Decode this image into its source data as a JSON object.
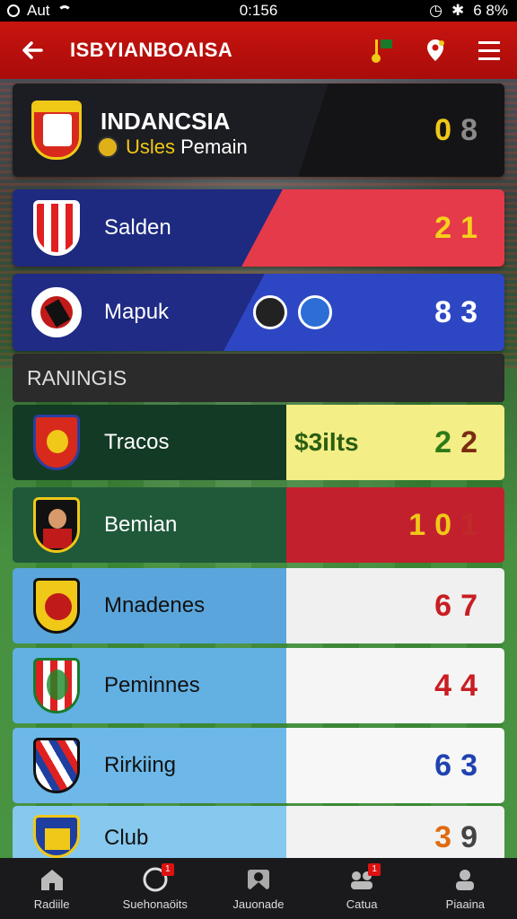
{
  "status_bar": {
    "left_text": "Aut",
    "time": "0:156",
    "battery": "6 8%"
  },
  "app_bar": {
    "title": "ISBYIANBOAISA",
    "back_icon": "back-arrow-icon",
    "actions": [
      "flag-icon",
      "location-pin-icon",
      "menu-icon"
    ]
  },
  "featured": {
    "title": "INDANCSIA",
    "subtitle_accent": "Usles",
    "subtitle_rest": " Pemain",
    "score_a": "0",
    "score_b": "8",
    "score_colors": [
      "#f0c818",
      "#8a8a8a"
    ]
  },
  "matches": [
    {
      "name": "Salden",
      "score_a": "2",
      "score_b": "1",
      "color_a": "#f6d21a",
      "color_b": "#f6d21a"
    },
    {
      "name": "Mapuk",
      "score_a": "8",
      "score_b": "3",
      "color_a": "#ffffff",
      "color_b": "#ffffff"
    }
  ],
  "section": {
    "title": "RANINGIS"
  },
  "rankings": [
    {
      "name": "Tracos",
      "extra": "$3ilts",
      "score_a": "2",
      "score_b": "2",
      "color_a": "#2f7a18",
      "color_b": "#7a2c12",
      "left_bg": "#133a24",
      "right_bg": "#f3ee86"
    },
    {
      "name": "Bemian",
      "extra": "",
      "score_a": "10",
      "score_b": "1",
      "color_a": "#f0c818",
      "color_b": "#c02a2a",
      "left_bg": "#20583a",
      "right_bg": "#c3202e"
    },
    {
      "name": "Mnadenes",
      "extra": "",
      "score_a": "6",
      "score_b": "7",
      "color_a": "#c81e22",
      "color_b": "#c81e22",
      "left_bg": "#5aa6dc",
      "right_bg": "#f0f0f0"
    },
    {
      "name": "Peminnes",
      "extra": "",
      "score_a": "4",
      "score_b": "4",
      "color_a": "#c81e22",
      "color_b": "#c81e22",
      "left_bg": "#63b0e2",
      "right_bg": "#f5f5f5"
    },
    {
      "name": "Rirkiing",
      "extra": "",
      "score_a": "6",
      "score_b": "3",
      "color_a": "#1f43b0",
      "color_b": "#1f43b0",
      "left_bg": "#6db8e8",
      "right_bg": "#f7f7f7"
    },
    {
      "name": "Club",
      "extra": "",
      "score_a": "3",
      "score_b": "9",
      "color_a": "#e06a10",
      "color_b": "#444444",
      "left_bg": "#86c8ee",
      "right_bg": "#f2f2f2"
    }
  ],
  "nav": [
    {
      "label": "Radiile",
      "icon": "home-icon",
      "badge": ""
    },
    {
      "label": "Suehonaöits",
      "icon": "circle-icon",
      "badge": "1"
    },
    {
      "label": "Jauonade",
      "icon": "person-icon",
      "badge": ""
    },
    {
      "label": "Catua",
      "icon": "group-icon",
      "badge": "1"
    },
    {
      "label": "Piaaina",
      "icon": "profile-icon",
      "badge": ""
    }
  ]
}
